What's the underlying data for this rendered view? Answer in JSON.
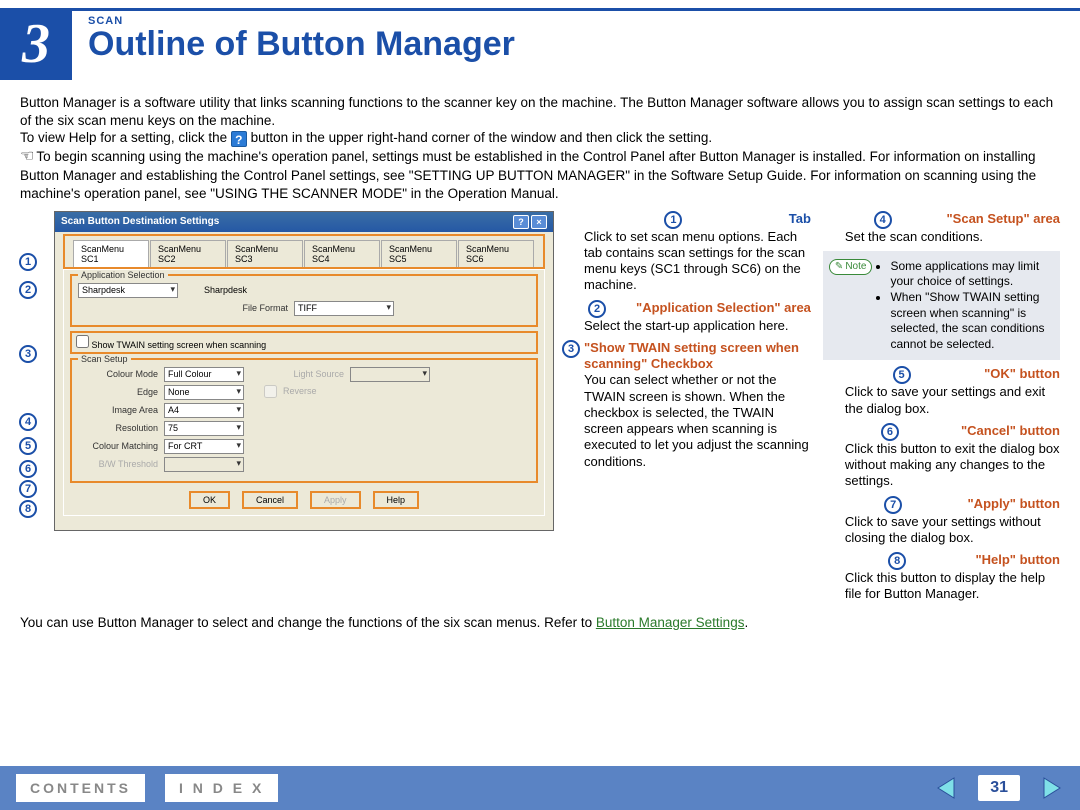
{
  "header": {
    "chapter_num": "3",
    "section_label": "SCAN",
    "title": "Outline of Button Manager"
  },
  "intro": {
    "p1": "Button Manager is a software utility that links scanning functions to the scanner key on the machine. The Button Manager software allows you to assign scan settings to each of the six scan menu keys on the machine.",
    "p2a": "To view Help for a setting, click the ",
    "p2b": " button in the upper right-hand corner of the window and then click the setting.",
    "p3a": "To begin scanning using the machine's operation panel, settings must be established in the Control Panel after Button Manager is installed. For information on installing Button Manager and establishing the Control Panel settings, see \"SETTING UP BUTTON MANAGER\" in the Software Setup Guide. For information on scanning using the machine's operation panel, see \"USING THE SCANNER MODE\" in the Operation Manual."
  },
  "dialog": {
    "title": "Scan Button Destination Settings",
    "tabs": [
      "ScanMenu SC1",
      "ScanMenu SC2",
      "ScanMenu SC3",
      "ScanMenu SC4",
      "ScanMenu SC5",
      "ScanMenu SC6"
    ],
    "app_sel_legend": "Application Selection",
    "app_sel_value": "Sharpdesk",
    "app_sel_side_label": "Sharpdesk",
    "file_format_label": "File Format",
    "file_format_value": "TIFF",
    "twain_checkbox_label": "Show TWAIN setting screen when scanning",
    "scan_setup_legend": "Scan Setup",
    "fields": {
      "colour_mode": {
        "label": "Colour Mode",
        "value": "Full Colour"
      },
      "edge": {
        "label": "Edge",
        "value": "None"
      },
      "image_area": {
        "label": "Image Area",
        "value": "A4"
      },
      "resolution": {
        "label": "Resolution",
        "value": "75"
      },
      "colour_matching": {
        "label": "Colour Matching",
        "value": "For CRT"
      },
      "bw_threshold": {
        "label": "B/W Threshold",
        "value": ""
      },
      "light_source": {
        "label": "Light Source",
        "value": ""
      },
      "reverse": {
        "label": "Reverse"
      }
    },
    "buttons": {
      "ok": "OK",
      "cancel": "Cancel",
      "apply": "Apply",
      "help": "Help"
    }
  },
  "markers": [
    "1",
    "2",
    "3",
    "4",
    "5",
    "6",
    "7",
    "8"
  ],
  "callouts": {
    "c1": {
      "head": "Tab",
      "body": "Click to set scan menu options. Each tab contains scan settings for the scan menu keys (SC1 through SC6) on the machine."
    },
    "c2": {
      "head": "\"Application Selection\" area",
      "body": "Select the start-up application here."
    },
    "c3": {
      "head": "\"Show TWAIN setting screen when scanning\" Checkbox",
      "body": "You can select whether or not the TWAIN screen is shown. When the checkbox is selected, the TWAIN screen appears when scanning is executed to let you adjust the scanning conditions."
    },
    "c4": {
      "head": "\"Scan Setup\" area",
      "body": "Set the scan conditions."
    },
    "c5": {
      "head": "\"OK\" button",
      "body": "Click to save your settings and exit the dialog box."
    },
    "c6": {
      "head": "\"Cancel\" button",
      "body": "Click this button to exit the dialog box without making any changes to the settings."
    },
    "c7": {
      "head": "\"Apply\" button",
      "body": "Click to save your settings without closing the dialog box."
    },
    "c8": {
      "head": "\"Help\" button",
      "body": "Click this button to display the help file for Button Manager."
    }
  },
  "note": {
    "label": "Note",
    "items": [
      "Some applications may limit your choice of settings.",
      "When \"Show TWAIN setting screen when scanning\" is selected, the scan conditions cannot be selected."
    ]
  },
  "closing": {
    "text_a": "You can use Button Manager to select and change the functions of the six scan menus. Refer to ",
    "link": "Button Manager Settings",
    "text_b": "."
  },
  "footer": {
    "contents": "CONTENTS",
    "index": "I  N  D  E  X",
    "page": "31"
  },
  "help_icon_char": "?"
}
